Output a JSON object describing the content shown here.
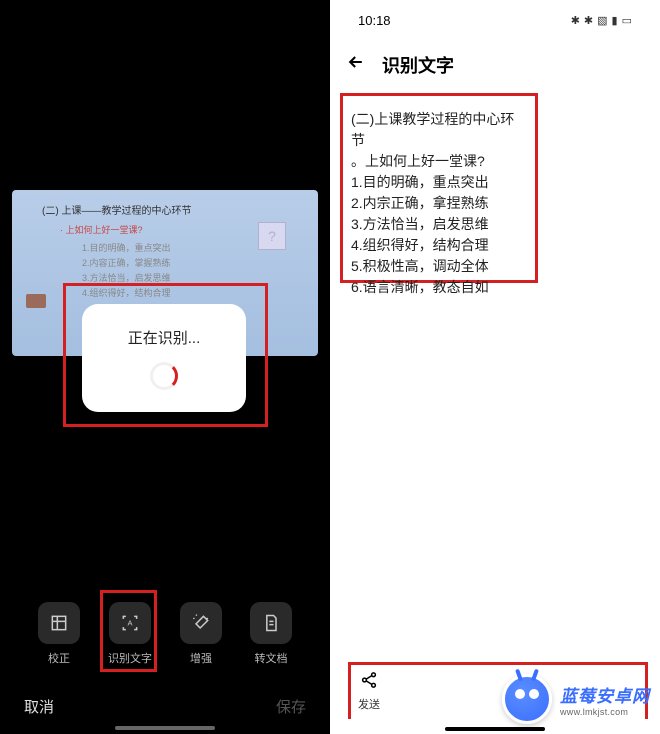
{
  "left": {
    "captured": {
      "header": "(二) 上课——教学过程的中心环节",
      "subhead": "· 上如何上好一堂课?",
      "lines": [
        "1.目的明确，重点突出",
        "2.内容正确，掌握熟练",
        "3.方法恰当，启发思维",
        "4.组织得好，结构合理"
      ]
    },
    "dialog": {
      "text": "正在识别..."
    },
    "toolbar": {
      "straighten": "校正",
      "ocr": "识别文字",
      "enhance": "增强",
      "convert": "转文档"
    },
    "bottom": {
      "cancel": "取消",
      "save": "保存"
    }
  },
  "right": {
    "status": {
      "time": "10:18"
    },
    "header": {
      "title": "识别文字"
    },
    "lines": [
      "(二)上课教学过程的中心环节",
      "。上如何上好一堂课?",
      "1.目的明确，重点突出",
      "2.内宗正确，拿捏熟练",
      "3.方法恰当，启发思维",
      "4.组织得好，结构合理",
      "5.积极性高，调动全体",
      "6.语言清晰，教态自如"
    ],
    "send": "发送"
  },
  "watermark": {
    "title": "蓝莓安卓网",
    "url": "www.lmkjst.com"
  }
}
